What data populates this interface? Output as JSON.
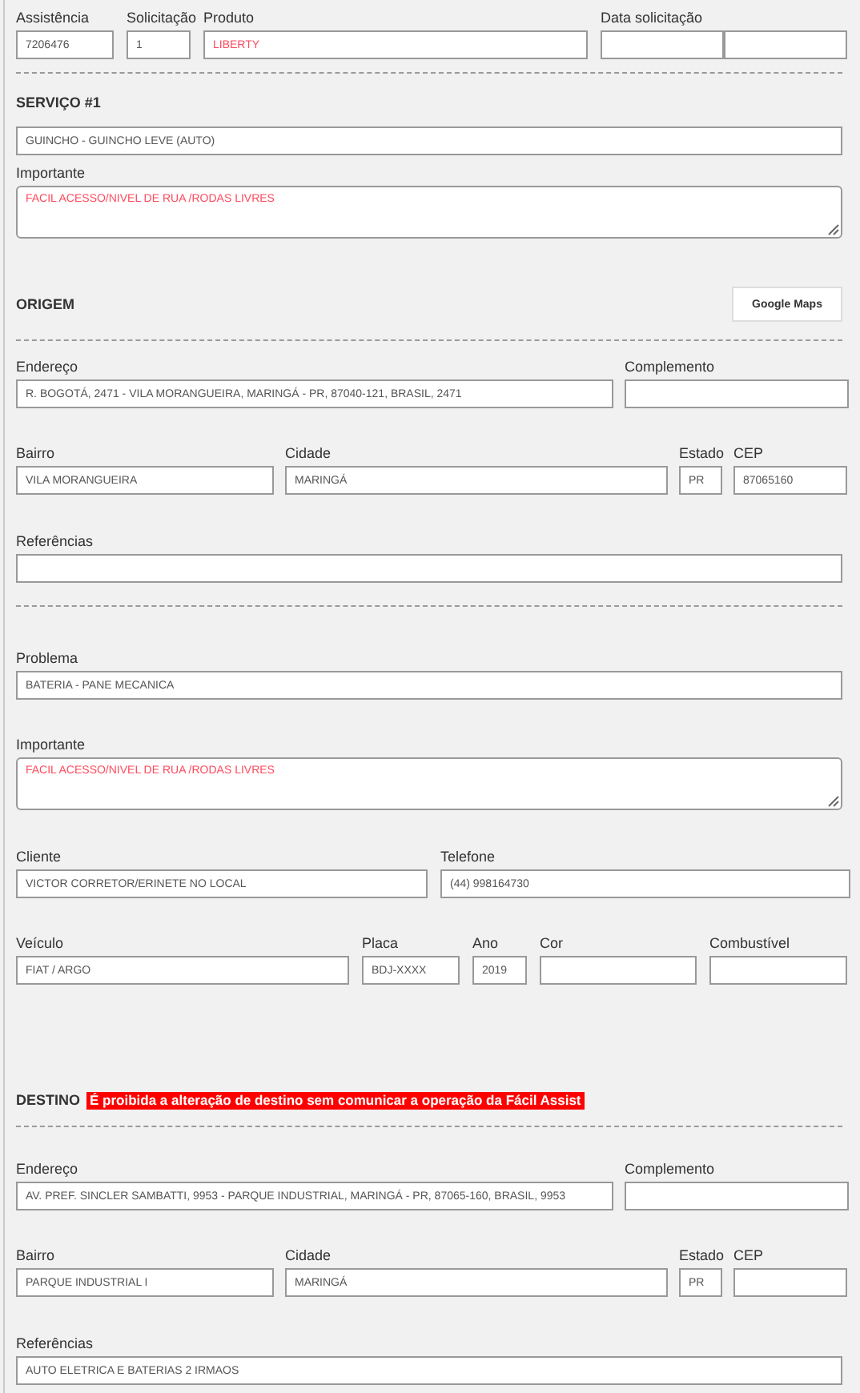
{
  "header": [
    {
      "label": "Assistência",
      "value": "7206476",
      "alert": false
    },
    {
      "label": "Solicitação",
      "value": "1",
      "alert": false
    },
    {
      "label": "Produto",
      "value": "LIBERTY",
      "alert": true
    },
    {
      "label": "Data solicitação",
      "kind": "split"
    }
  ],
  "service": {
    "title": "SERVIÇO #1",
    "type": {
      "value": "GUINCHO - GUINCHO LEVE (AUTO)",
      "alert": false
    },
    "important": {
      "label": "Importante",
      "value": "FACIL ACESSO/NIVEL DE RUA /RODAS LIVRES",
      "alert": true
    }
  },
  "origin": {
    "title": "ORIGEM",
    "map_button": "Google Maps",
    "address_row": [
      {
        "label": "Endereço",
        "value": "R. BOGOTÁ, 2471 - VILA MORANGUEIRA, MARINGÁ - PR, 87040-121, BRASIL, 2471",
        "alert": false
      },
      {
        "label": "Complemento"
      }
    ],
    "locality_row": [
      {
        "label": "Bairro",
        "value": "VILA MORANGUEIRA",
        "alert": false
      },
      {
        "label": "Cidade",
        "value": "MARINGÁ",
        "alert": false
      },
      {
        "label": "Estado",
        "value": "PR",
        "alert": false
      },
      {
        "label": "CEP",
        "value": "87065160",
        "alert": false
      }
    ],
    "references": {
      "label": "Referências"
    }
  },
  "details": {
    "problem": {
      "label": "Problema",
      "value": "BATERIA - PANE MECANICA",
      "alert": false
    },
    "important": {
      "label": "Importante",
      "value": "FACIL ACESSO/NIVEL DE RUA /RODAS LIVRES",
      "alert": true
    },
    "client_row": [
      {
        "label": "Cliente",
        "value": "VICTOR CORRETOR/ERINETE NO LOCAL",
        "alert": false
      },
      {
        "label": "Telefone",
        "value": "(44) 998164730",
        "alert": false
      }
    ],
    "vehicle_row": [
      {
        "label": "Veículo",
        "value": "FIAT / ARGO",
        "alert": false
      },
      {
        "label": "Placa",
        "value": "BDJ-XXXX",
        "alert": false
      },
      {
        "label": "Ano",
        "value": "2019",
        "alert": false
      },
      {
        "label": "Cor"
      },
      {
        "label": "Combustível"
      }
    ]
  },
  "destination": {
    "title": "DESTINO",
    "warning": "É proibida a alteração de destino sem comunicar a operação da Fácil Assist",
    "address_row": [
      {
        "label": "Endereço",
        "value": "AV. PREF. SINCLER SAMBATTI, 9953 - PARQUE INDUSTRIAL, MARINGÁ - PR, 87065-160, BRASIL, 9953",
        "alert": false
      },
      {
        "label": "Complemento"
      }
    ],
    "locality_row": [
      {
        "label": "Bairro",
        "value": "PARQUE INDUSTRIAL I",
        "alert": false
      },
      {
        "label": "Cidade",
        "value": "MARINGÁ",
        "alert": false
      },
      {
        "label": "Estado",
        "value": "PR",
        "alert": false
      },
      {
        "label": "CEP"
      }
    ],
    "references": {
      "label": "Referências",
      "value": "AUTO ELETRICA E BATERIAS 2 IRMAOS",
      "alert": false
    }
  }
}
